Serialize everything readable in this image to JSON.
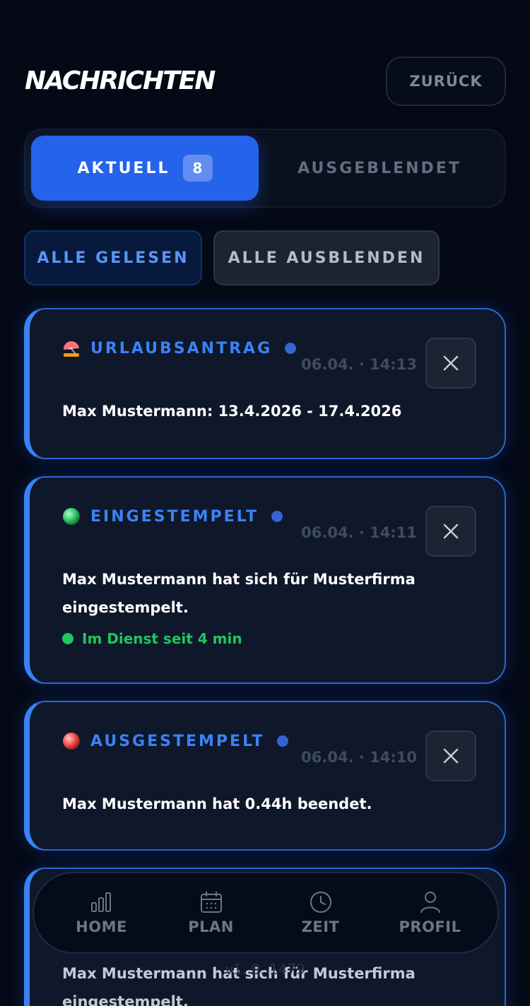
{
  "header": {
    "title": "NACHRICHTEN",
    "back_label": "ZURÜCK"
  },
  "tabs": {
    "active": {
      "label": "AKTUELL",
      "count": "8"
    },
    "inactive": {
      "label": "AUSGEBLENDET"
    }
  },
  "actions": {
    "mark_read_label": "ALLE GELESEN",
    "hide_all_label": "ALLE AUSBLENDEN"
  },
  "notifications": [
    {
      "icon": "beach-umbrella-icon",
      "title": "URLAUBSANTRAG",
      "time": "06.04. · 14:13",
      "body": "Max Mustermann: 13.4.2026 - 17.4.2026",
      "unread": true
    },
    {
      "icon": "green-circle-icon",
      "title": "EINGESTEMPELT",
      "time": "06.04. · 14:11",
      "body": "Max Mustermann hat sich für Musterfirma eingestempelt.",
      "status": "Im Dienst seit 4 min",
      "unread": true
    },
    {
      "icon": "red-circle-icon",
      "title": "AUSGESTEMPELT",
      "time": "06.04. · 14:10",
      "body": "Max Mustermann hat 0.44h beendet.",
      "unread": true
    },
    {
      "body": "Max Mustermann hat sich für Musterfirma eingestempelt."
    }
  ],
  "nav": {
    "items": [
      {
        "label": "HOME",
        "icon": "bar-chart-icon"
      },
      {
        "label": "PLAN",
        "icon": "calendar-icon"
      },
      {
        "label": "ZEIT",
        "icon": "clock-icon"
      },
      {
        "label": "PROFIL",
        "icon": "user-icon"
      }
    ]
  },
  "footer": {
    "version": "v1. 0. 1479"
  },
  "colors": {
    "accent": "#3b82f6",
    "active_tab": "#2563eb",
    "status_green": "#22c55e",
    "background": "#040915"
  }
}
